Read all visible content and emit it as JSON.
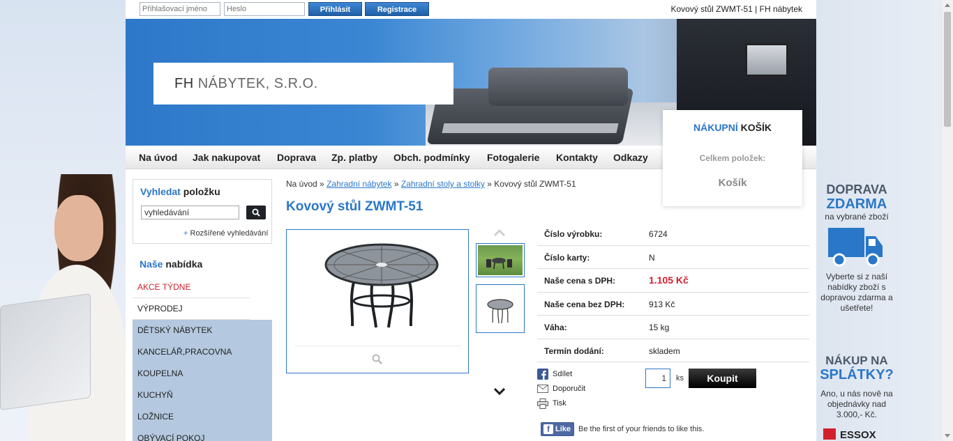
{
  "top_bar": {
    "login_placeholder": "Přihlašovací jméno",
    "password_placeholder": "Heslo",
    "login_button": "Přihlásit",
    "register_button": "Registrace",
    "page_title": "Kovový stůl ZWMT-51 | FH nábytek"
  },
  "banner": {
    "logo_fh": "FH",
    "logo_rest": "NÁBYTEK, S.R.O."
  },
  "nav": [
    "Na úvod",
    "Jak nakupovat",
    "Doprava",
    "Zp. platby",
    "Obch. podmínky",
    "Fotogalerie",
    "Kontakty",
    "Odkazy"
  ],
  "cart": {
    "title_blue": "NÁKUPNÍ",
    "title_rest": "KOŠÍK",
    "items_label": "Celkem položek:",
    "link": "Košík"
  },
  "search": {
    "head_blue": "Vyhledat",
    "head_rest": "položku",
    "value": "vyhledávání",
    "advanced_plus": "+",
    "advanced_label": "Rozšířené vyhledávání"
  },
  "menu": {
    "head_blue": "Naše",
    "head_rest": "nabídka",
    "items": [
      "AKCE TÝDNE",
      "VÝPRODEJ",
      "DĚTSKÝ NÁBYTEK",
      "KANCELÁŘ,PRACOVNA",
      "KOUPELNA",
      "KUCHYŇ",
      "LOŽNICE",
      "OBÝVACÍ POKOJ"
    ]
  },
  "breadcrumb": {
    "home": "Na úvod",
    "sep": "»",
    "cat1": "Zahradní nábytek",
    "cat2": "Zahradní stoly a stolky",
    "current": "Kovový stůl ZWMT-51"
  },
  "product": {
    "title": "Kovový stůl ZWMT-51",
    "specs": [
      {
        "key": "Číslo výrobku:",
        "value": "6724"
      },
      {
        "key": "Číslo karty:",
        "value": "N"
      },
      {
        "key": "Naše cena s DPH:",
        "value": "1.105 Kč"
      },
      {
        "key": "Naše cena bez DPH:",
        "value": "913 Kč"
      },
      {
        "key": "Váha:",
        "value": "15 kg"
      },
      {
        "key": "Termín dodání:",
        "value": "skladem"
      }
    ],
    "share": "Sdílet",
    "recommend": "Doporučit",
    "print": "Tisk",
    "qty": "1",
    "unit": "ks",
    "buy_button": "Koupit"
  },
  "facebook": {
    "like": "Like",
    "text": "Be the first of your friends to like this."
  },
  "right_promo": {
    "h1_line1": "DOPRAVA",
    "h1_line2": "ZDARMA",
    "h1_small": "na vybrané zboží",
    "text1": "Vyberte si z naší nabídky zboží s dopravou zdarma a ušetřete!",
    "h2_line1": "NÁKUP NA",
    "h2_line2": "SPLÁTKY?",
    "text2": "Ano, u nás nově na objednávky nad 3.000,- Kč.",
    "essox": "ESSOX"
  },
  "colors": {
    "accent": "#2a77c9",
    "price_red": "#d21f2b",
    "menu_bg": "#b4c8df"
  }
}
